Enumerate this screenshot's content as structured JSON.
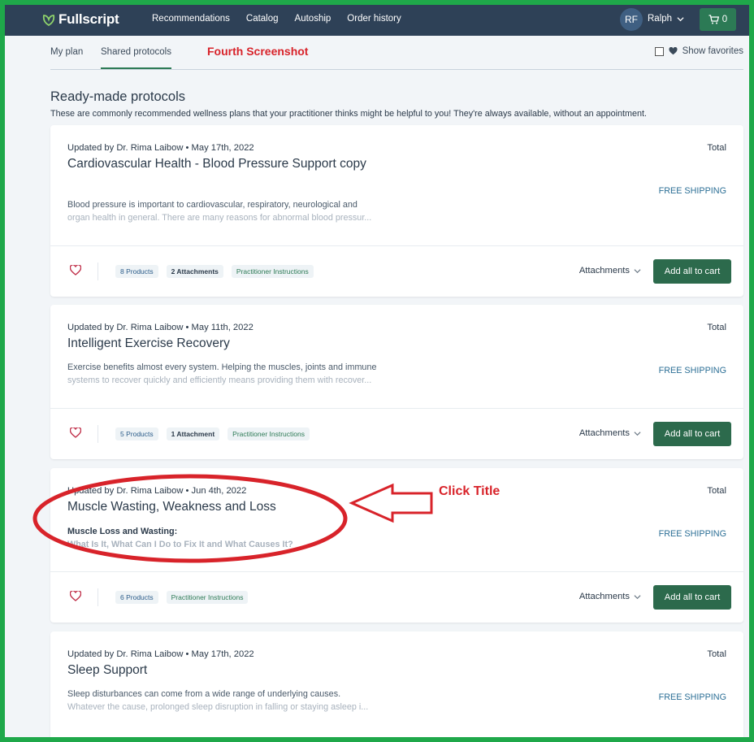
{
  "app": {
    "logo_text": "Fullscript",
    "nav": [
      "Recommendations",
      "Catalog",
      "Autoship",
      "Order history"
    ],
    "user_initials": "RF",
    "user_name": "Ralph",
    "cart_count": "0"
  },
  "tabs": {
    "my_plan": "My plan",
    "shared_protocols": "Shared protocols",
    "annotation": "Fourth Screenshot",
    "show_favorites": "Show favorites"
  },
  "page": {
    "heading": "Ready-made protocols",
    "subheading": "These are commonly recommended wellness plans that your practitioner thinks might be helpful to you! They're always available, without an appointment."
  },
  "cards": [
    {
      "meta": "Updated by Dr. Rima Laibow • May 17th, 2022",
      "title": "Cardiovascular Health - Blood Pressure Support copy",
      "desc_line1": "Blood pressure is important to cardiovascular, respiratory, neurological and",
      "desc_line2": "organ health in general. There are many reasons for abnormal blood pressur...",
      "total_label": "Total",
      "shipping": "FREE SHIPPING",
      "chips": [
        "8 Products",
        "2 Attachments",
        "Practitioner Instructions"
      ],
      "attachments_label": "Attachments",
      "add_label": "Add all to cart"
    },
    {
      "meta": "Updated by Dr. Rima Laibow • May 11th, 2022",
      "title": "Intelligent Exercise Recovery",
      "desc_line1": "Exercise benefits almost every system. Helping the muscles, joints and immune",
      "desc_line2": "systems to recover quickly and efficiently means providing them with recover...",
      "total_label": "Total",
      "shipping": "FREE SHIPPING",
      "chips": [
        "5 Products",
        "1 Attachment",
        "Practitioner Instructions"
      ],
      "attachments_label": "Attachments",
      "add_label": "Add all to cart"
    },
    {
      "meta": "Updated by Dr. Rima Laibow • Jun 4th, 2022",
      "title": "Muscle Wasting, Weakness and Loss",
      "desc_line1": "Muscle Loss and Wasting:",
      "desc_line2": "What Is It, What Can I Do to Fix It and What Causes It?",
      "total_label": "Total",
      "shipping": "FREE SHIPPING",
      "chips": [
        "6 Products",
        "Practitioner Instructions"
      ],
      "attachments_label": "Attachments",
      "add_label": "Add all to cart"
    },
    {
      "meta": "Updated by Dr. Rima Laibow • May 17th, 2022",
      "title": "Sleep Support",
      "desc_line1": "Sleep disturbances can come from a wide range of underlying causes.",
      "desc_line2": "Whatever the cause, prolonged sleep disruption in falling or staying asleep i...",
      "total_label": "Total",
      "shipping": "FREE SHIPPING"
    }
  ],
  "annotation": {
    "click_label": "Click Title",
    "color": "#d8232a"
  },
  "colors": {
    "nav_bg": "#2e4157",
    "accent_green": "#2c7a55",
    "frame_green": "#1fa84a"
  }
}
